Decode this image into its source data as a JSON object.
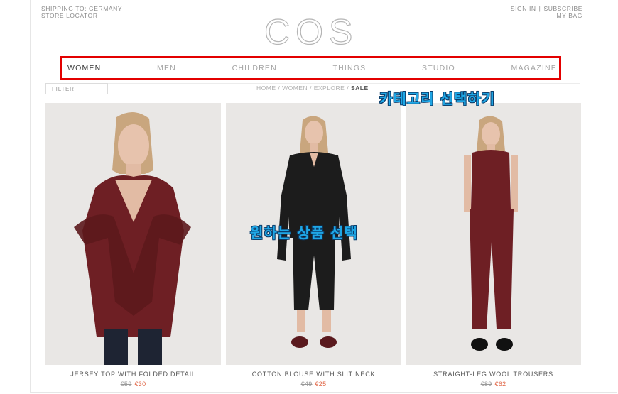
{
  "header": {
    "shipping": "SHIPPING TO: GERMANY",
    "store_locator": "STORE LOCATOR",
    "sign_in": "SIGN IN",
    "separator": "|",
    "subscribe": "SUBSCRIBE",
    "my_bag": "MY BAG",
    "logo": "COS"
  },
  "nav": {
    "items": [
      {
        "label": "WOMEN"
      },
      {
        "label": "MEN"
      },
      {
        "label": "CHILDREN"
      },
      {
        "label": "THINGS"
      },
      {
        "label": "STUDIO"
      },
      {
        "label": "MAGAZINE"
      }
    ],
    "highlight_color": "#e30000"
  },
  "filter": {
    "label": "FILTER"
  },
  "breadcrumb": {
    "path": "HOME / WOMEN / EXPLORE / ",
    "current": "SALE"
  },
  "annotations": {
    "category": "카테고리 선택하기",
    "product": "원하는 상품 선택",
    "color": "#1fa7e6"
  },
  "products": [
    {
      "name": "JERSEY TOP WITH FOLDED DETAIL",
      "old_price": "€59",
      "new_price": "€30"
    },
    {
      "name": "COTTON BLOUSE WITH SLIT NECK",
      "old_price": "€49",
      "new_price": "€25"
    },
    {
      "name": "STRAIGHT-LEG WOOL TROUSERS",
      "old_price": "€89",
      "new_price": "€62"
    }
  ],
  "colors": {
    "burgundy": "#6e1f24",
    "black": "#1c1c1c",
    "sale": "#e06545"
  }
}
